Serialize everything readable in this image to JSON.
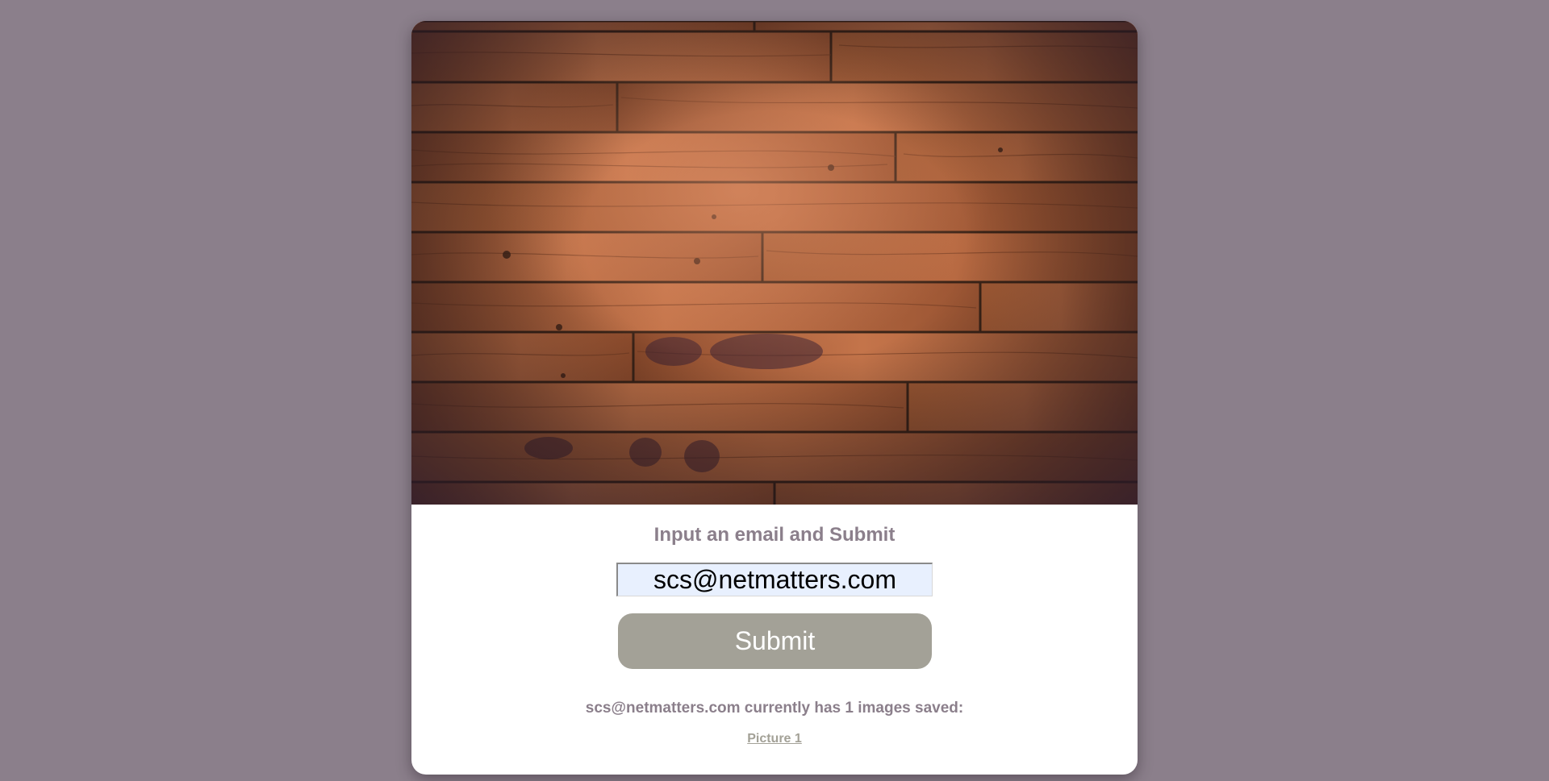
{
  "page": {
    "background_color": "#8b7f8b",
    "card_color": "#ffffff",
    "accent_text_color": "#8b7f8b",
    "button_color": "#a3a197",
    "input_background": "#e8f0fe"
  },
  "photo": {
    "subject": "wooden-floorboards"
  },
  "form": {
    "heading": "Input an email and Submit",
    "email_value": "scs@netmatters.com",
    "submit_label": "Submit"
  },
  "results": {
    "status_text": "scs@netmatters.com currently has 1 images saved:",
    "links": [
      "Picture 1"
    ]
  }
}
